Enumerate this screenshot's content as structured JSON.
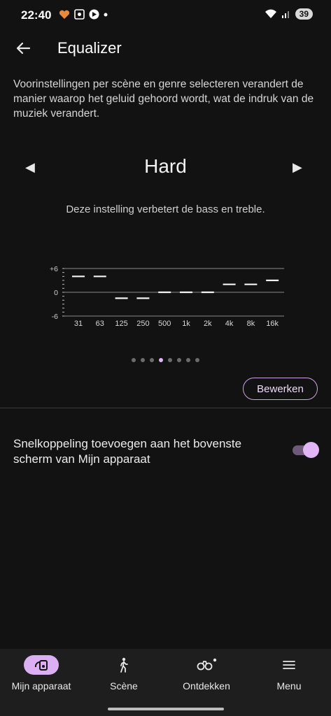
{
  "status": {
    "time": "22:40",
    "battery": "39"
  },
  "header": {
    "title": "Equalizer"
  },
  "description": "Voorinstellingen per scène en genre selecteren verandert de manier waarop het geluid gehoord wordt, wat de indruk van de muziek verandert.",
  "preset": {
    "name": "Hard",
    "description": "Deze instelling verbetert de bass en treble.",
    "pages": 8,
    "active_page": 4
  },
  "chart_data": {
    "type": "line",
    "categories": [
      "31",
      "63",
      "125",
      "250",
      "500",
      "1k",
      "2k",
      "4k",
      "8k",
      "16k"
    ],
    "values": [
      4,
      4,
      -1.5,
      -1.5,
      0,
      0,
      0,
      2,
      2,
      3
    ],
    "yticks": [
      "+6",
      "0",
      "-6"
    ],
    "ylim": [
      -6,
      6
    ],
    "grid": true
  },
  "edit_button": "Bewerken",
  "shortcut": {
    "label": "Snelkoppeling toevoegen aan het bovenste scherm van Mijn apparaat",
    "enabled": true
  },
  "nav": {
    "items": [
      {
        "label": "Mijn apparaat",
        "icon": "device-icon",
        "active": true
      },
      {
        "label": "Scène",
        "icon": "walking-person-icon",
        "active": false
      },
      {
        "label": "Ontdekken",
        "icon": "binoculars-icon",
        "active": false
      },
      {
        "label": "Menu",
        "icon": "menu-icon",
        "active": false
      }
    ]
  },
  "colors": {
    "background": "#121212",
    "accent": "#dcaef2",
    "nav_background": "#1e1e1e"
  }
}
